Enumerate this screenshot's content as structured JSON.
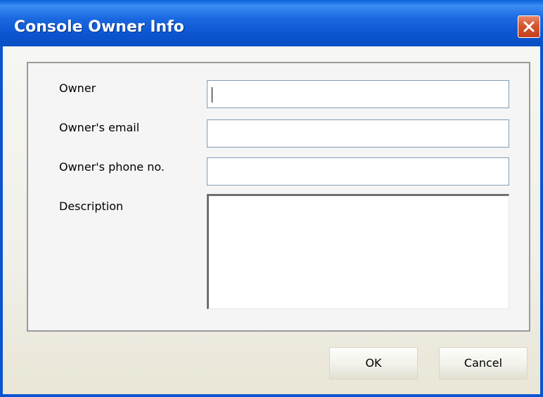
{
  "window": {
    "title": "Console Owner Info",
    "title_color": "#ffffff",
    "titlebar_color": "#0b54d0",
    "close_button_color": "#d4552f"
  },
  "form": {
    "fields": [
      {
        "label": "Owner",
        "value": "",
        "focused": true
      },
      {
        "label": "Owner's email",
        "value": ""
      },
      {
        "label": "Owner's phone no.",
        "value": ""
      },
      {
        "label": "Description",
        "value": "",
        "multiline": true
      }
    ]
  },
  "buttons": {
    "ok_label": "OK",
    "cancel_label": "Cancel"
  }
}
